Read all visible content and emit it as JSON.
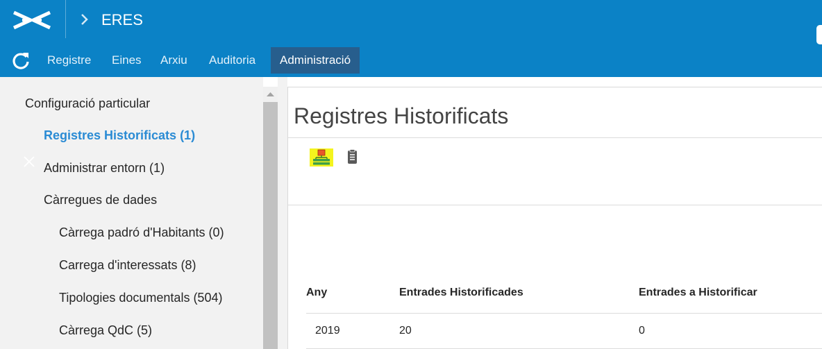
{
  "header": {
    "app_title": "ERES",
    "brand_color": "#0b82c6",
    "logo_icon": "eres-logo-icon",
    "chevron_icon": "chevron-right-icon"
  },
  "nav": {
    "refresh_icon": "refresh-icon",
    "items": [
      {
        "label": "Registre"
      },
      {
        "label": "Eines"
      },
      {
        "label": "Arxiu"
      },
      {
        "label": "Auditoria"
      },
      {
        "label": "Administració",
        "active": true
      }
    ],
    "active_color": "#275e8d"
  },
  "sidebar": {
    "section_title": "Configuració particular",
    "items": [
      {
        "label": "Registres Historificats (1)",
        "active": true
      },
      {
        "label": "Administrar entorn (1)"
      },
      {
        "label": "Càrregues de dades"
      },
      {
        "label": "Càrrega padró d'Habitants (0)"
      },
      {
        "label": "Carrega d'interessats (8)"
      },
      {
        "label": "Tipologies documentals (504)"
      },
      {
        "label": "Càrrega QdC (5)"
      }
    ],
    "active_color": "#2a8bd4"
  },
  "main": {
    "page_title": "Registres Historificats",
    "toolbar": [
      {
        "icon": "sitemap-icon",
        "highlighted": true
      },
      {
        "icon": "clipboard-icon"
      }
    ],
    "table": {
      "columns": [
        "Any",
        "Entrades Historificades",
        "Entrades a Historificar"
      ],
      "rows": [
        [
          "2019",
          "20",
          "0"
        ]
      ]
    }
  }
}
